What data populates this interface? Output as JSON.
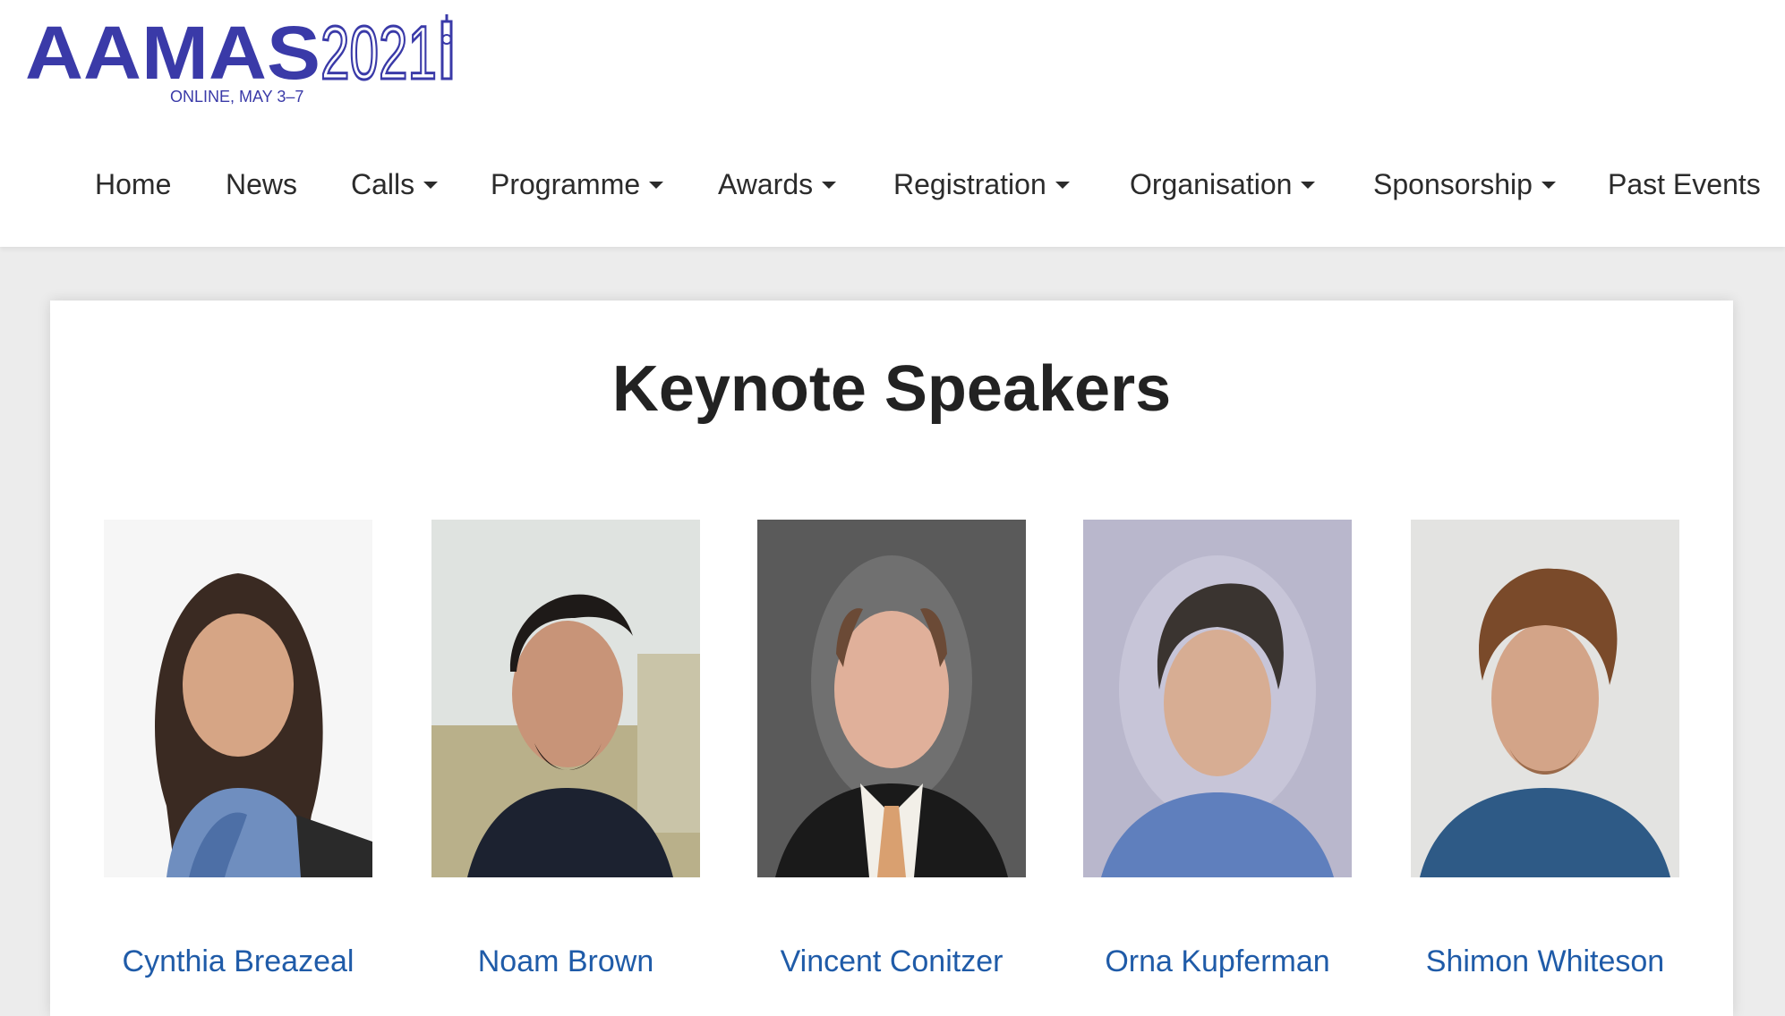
{
  "logo": {
    "title": "AAMAS2021",
    "subtitle": "ONLINE, MAY 3–7"
  },
  "nav": {
    "items": [
      {
        "label": "Home"
      },
      {
        "label": "News"
      },
      {
        "label": "Calls",
        "dropdown": true
      },
      {
        "label": "Programme",
        "dropdown": true
      },
      {
        "label": "Awards",
        "dropdown": true
      },
      {
        "label": "Registration",
        "dropdown": true
      },
      {
        "label": "Organisation",
        "dropdown": true
      },
      {
        "label": "Sponsorship",
        "dropdown": true
      },
      {
        "label": "Past Events"
      }
    ]
  },
  "main": {
    "title": "Keynote Speakers",
    "speakers": [
      {
        "name": "Cynthia Breazeal"
      },
      {
        "name": "Noam Brown"
      },
      {
        "name": "Vincent Conitzer"
      },
      {
        "name": "Orna Kupferman"
      },
      {
        "name": "Shimon Whiteson"
      }
    ]
  },
  "colors": {
    "brand": "#3a3aa8",
    "link": "#1f5ba8",
    "nav_text": "#2b2b2b",
    "page_bg": "#ececec"
  }
}
